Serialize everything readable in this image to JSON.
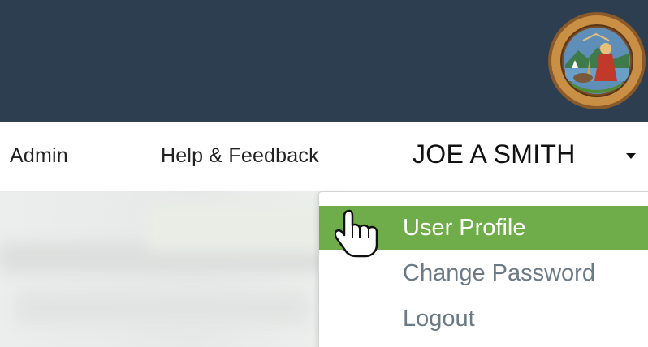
{
  "nav": {
    "admin": "Admin",
    "help": "Help & Feedback"
  },
  "user": {
    "name": "JOE A SMITH"
  },
  "menu": {
    "items": [
      {
        "label": "User Profile",
        "active": true
      },
      {
        "label": "Change Password",
        "active": false
      },
      {
        "label": "Logout",
        "active": false
      }
    ]
  },
  "colors": {
    "banner": "#2c3e50",
    "highlight": "#6fad4a",
    "menu_text": "#6b7a85"
  },
  "icons": {
    "seal": "state-controller-seal-icon",
    "caret": "caret-down-icon",
    "cursor": "hand-pointer-cursor-icon"
  }
}
